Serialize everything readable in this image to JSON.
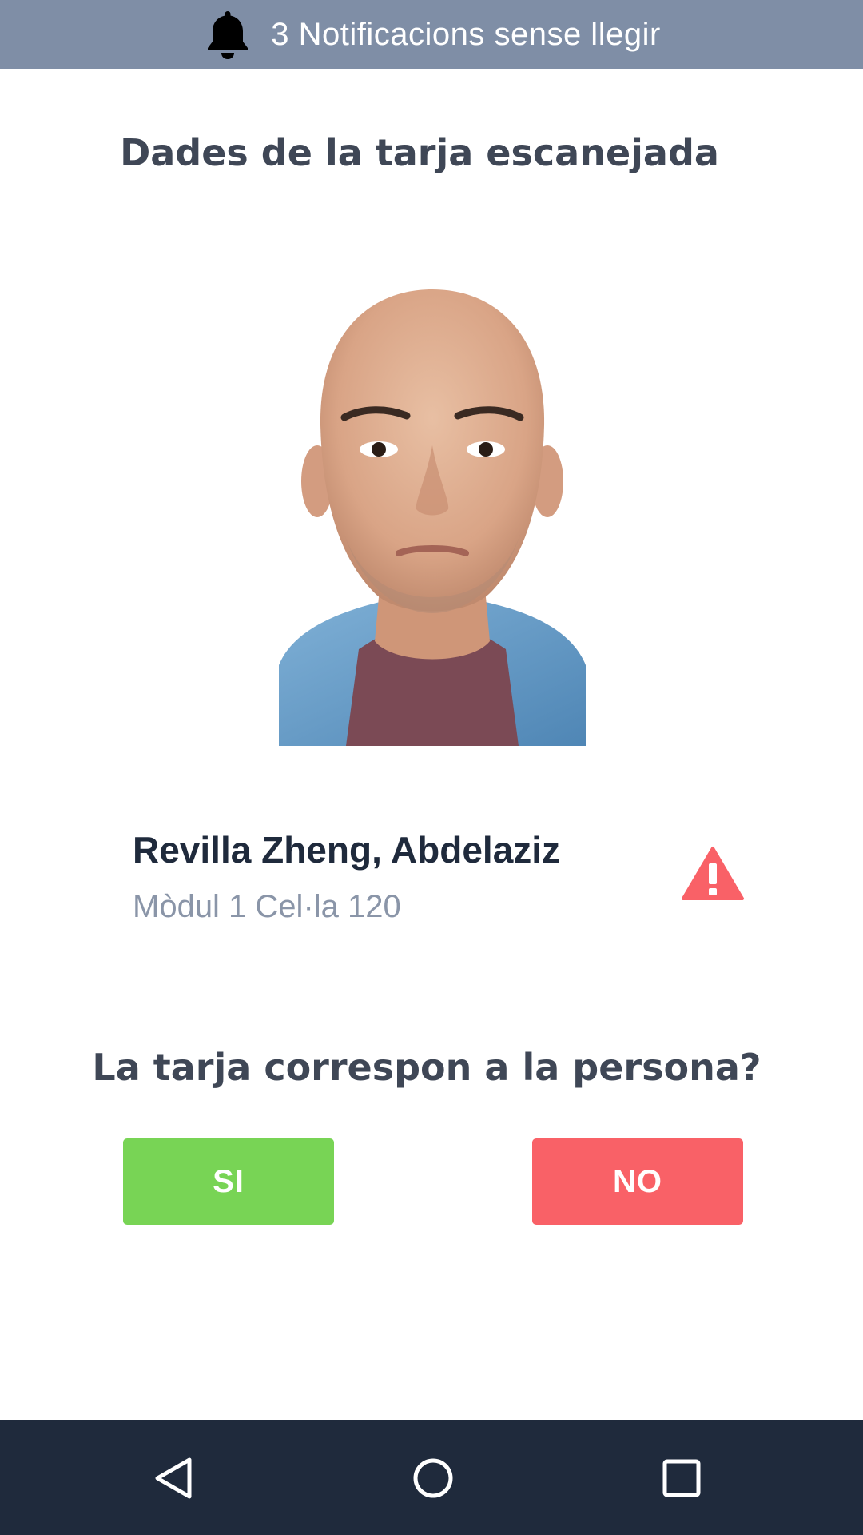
{
  "notification": {
    "icon": "bell-icon",
    "text": "3 Notificacions sense llegir",
    "background": "#7f8ea6"
  },
  "screen": {
    "title": "Dades de la tarja escanejada"
  },
  "person": {
    "photo_icon": "person-photo",
    "name": "Revilla Zheng, Abdelaziz",
    "location": "Mòdul 1 Cel·la 120",
    "alert_icon": "warning-icon",
    "alert_color": "#f96167"
  },
  "confirm": {
    "question": "La tarja correspon a la persona?",
    "yes_label": "SI",
    "no_label": "NO",
    "yes_color": "#78d455",
    "no_color": "#f96167"
  },
  "navbar": {
    "back_icon": "back-triangle-icon",
    "home_icon": "home-circle-icon",
    "recent_icon": "recent-apps-square-icon",
    "background": "#1f2a3c"
  }
}
